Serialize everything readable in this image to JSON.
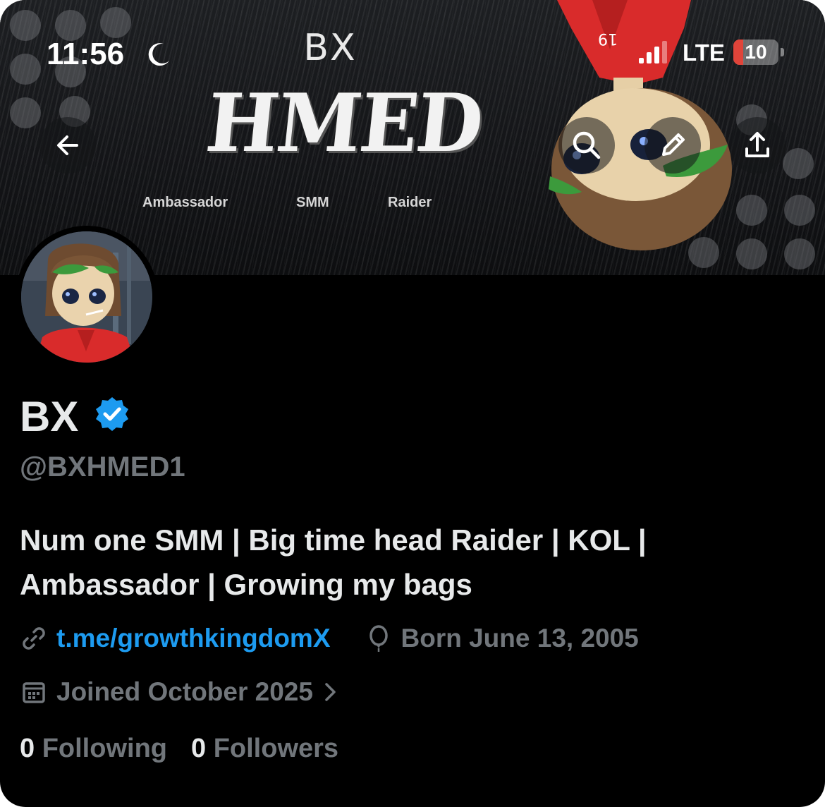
{
  "status_bar": {
    "time": "11:56",
    "network": "LTE",
    "battery": "10",
    "battery_level": 0.1
  },
  "banner": {
    "brand_small": "BX",
    "brand_big": "HMED",
    "tags": [
      "Ambassador",
      "SMM",
      "Raider"
    ]
  },
  "nav": {
    "back_icon": "arrow-left-icon",
    "search_icon": "search-icon",
    "edit_icon": "pencil-icon",
    "share_icon": "share-icon"
  },
  "profile": {
    "name": "BX",
    "verified_color": "#1d9bf0",
    "handle": "@BXHMED1",
    "bio_line1": "Num one SMM | Big time head Raider | KOL |",
    "bio_line2": "Ambassador | Growing my bags",
    "link": "t.me/growthkingdomX",
    "birthday": "Born June 13, 2005",
    "joined": "Joined October 2025",
    "following_count": "0",
    "following_label": "Following",
    "followers_count": "0",
    "followers_label": "Followers"
  }
}
